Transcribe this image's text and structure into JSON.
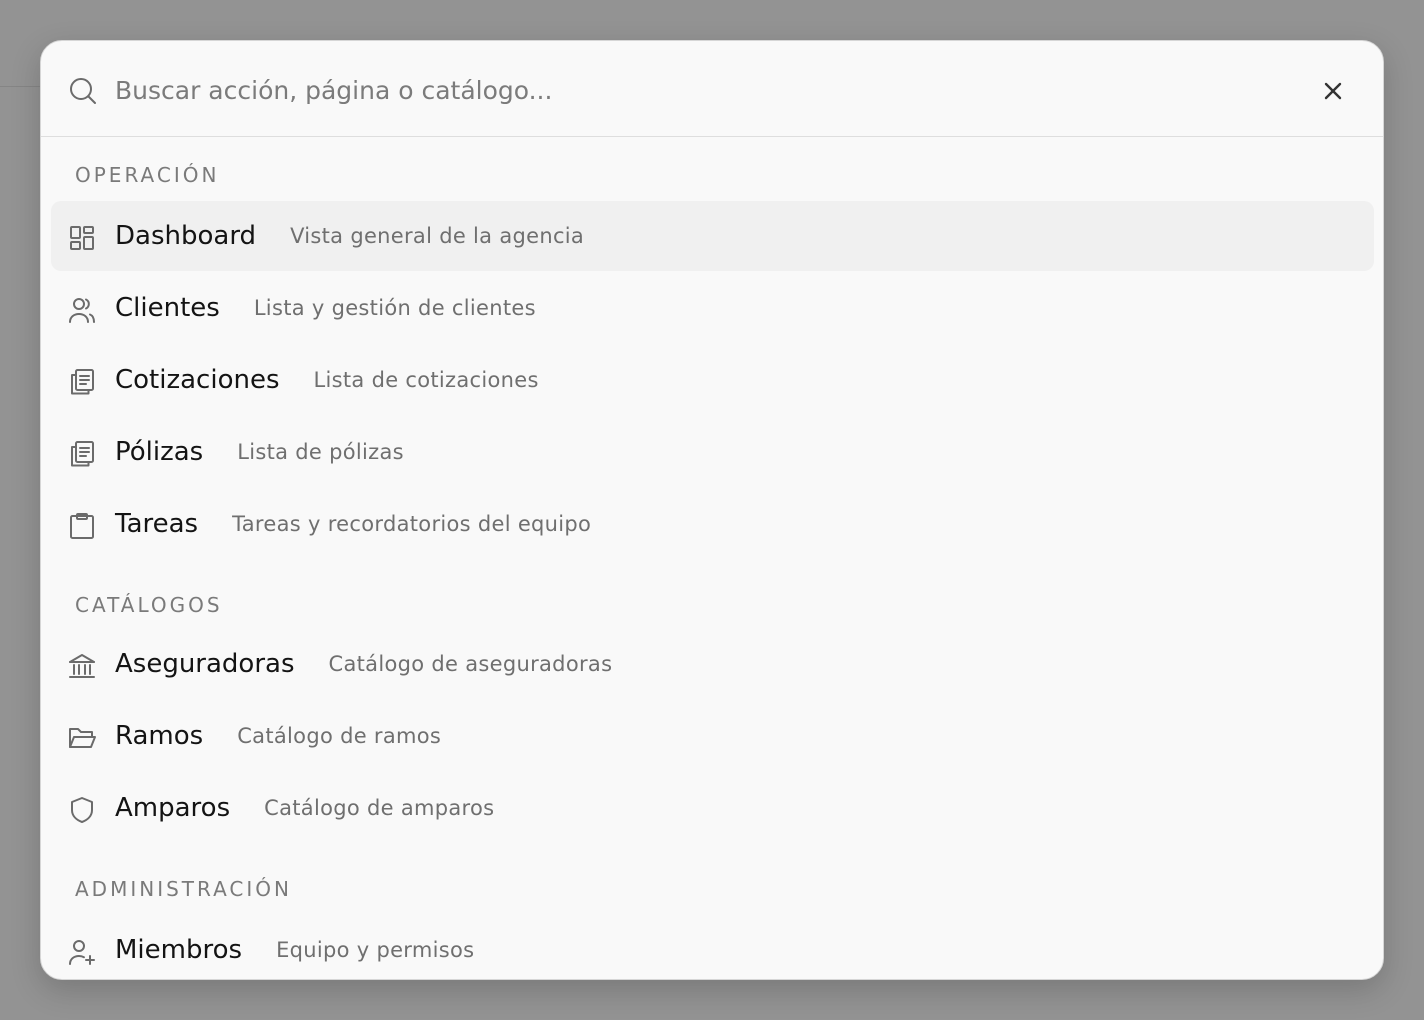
{
  "search": {
    "placeholder": "Buscar acción, página o catálogo...",
    "value": ""
  },
  "sections": [
    {
      "label": "OPERACIÓN",
      "items": [
        {
          "label": "Dashboard",
          "description": "Vista general de la agencia",
          "icon": "dashboard-icon",
          "active": true
        },
        {
          "label": "Clientes",
          "description": "Lista y gestión de clientes",
          "icon": "users-icon"
        },
        {
          "label": "Cotizaciones",
          "description": "Lista de cotizaciones",
          "icon": "documents-icon"
        },
        {
          "label": "Pólizas",
          "description": "Lista de pólizas",
          "icon": "documents-icon"
        },
        {
          "label": "Tareas",
          "description": "Tareas y recordatorios del equipo",
          "icon": "clipboard-icon"
        }
      ]
    },
    {
      "label": "CATÁLOGOS",
      "items": [
        {
          "label": "Aseguradoras",
          "description": "Catálogo de aseguradoras",
          "icon": "bank-icon"
        },
        {
          "label": "Ramos",
          "description": "Catálogo de ramos",
          "icon": "folder-open-icon"
        },
        {
          "label": "Amparos",
          "description": "Catálogo de amparos",
          "icon": "shield-icon"
        }
      ]
    },
    {
      "label": "ADMINISTRACIÓN",
      "items": [
        {
          "label": "Miembros",
          "description": "Equipo y permisos",
          "icon": "user-plus-icon"
        }
      ]
    }
  ],
  "colors": {
    "backdrop": "#939393",
    "panel": "#f9f9f9",
    "active_row": "#f0f0f0",
    "icon": "#6b6b6b"
  }
}
